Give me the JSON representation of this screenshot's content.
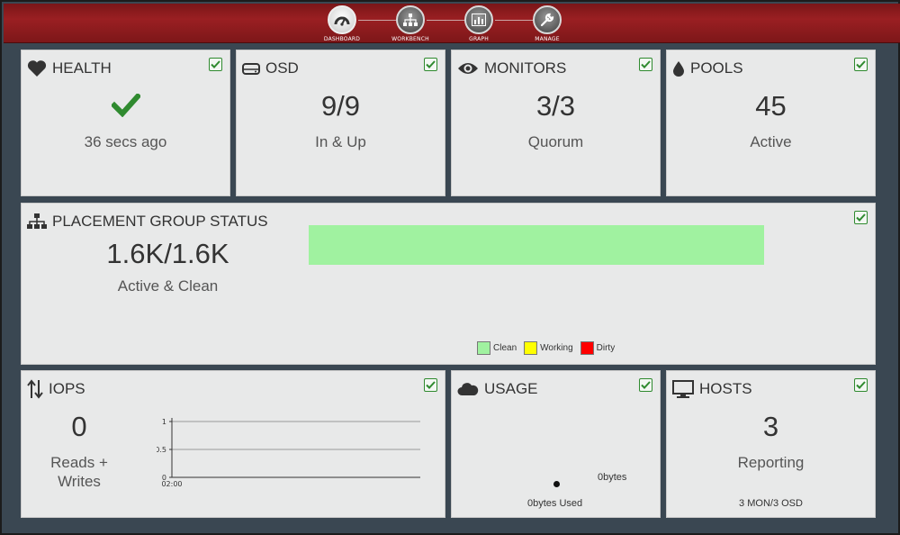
{
  "nav": {
    "items": [
      {
        "label": "DASHBOARD",
        "icon": "gauge-icon",
        "active": true
      },
      {
        "label": "WORKBENCH",
        "icon": "sitemap-icon",
        "active": false
      },
      {
        "label": "GRAPH",
        "icon": "chart-icon",
        "active": false
      },
      {
        "label": "MANAGE",
        "icon": "wrench-icon",
        "active": false
      }
    ]
  },
  "health": {
    "title": "HEALTH",
    "status_icon": "checkmark-icon",
    "label": "36 secs ago"
  },
  "osd": {
    "title": "OSD",
    "value": "9/9",
    "label": "In & Up"
  },
  "monitors": {
    "title": "MONITORS",
    "value": "3/3",
    "label": "Quorum"
  },
  "pools": {
    "title": "POOLS",
    "value": "45",
    "label": "Active"
  },
  "placement": {
    "title": "PLACEMENT GROUP STATUS",
    "value": "1.6K/1.6K",
    "label": "Active & Clean",
    "legend": [
      {
        "label": "Clean",
        "color": "#a0f2a0"
      },
      {
        "label": "Working",
        "color": "#ffff00"
      },
      {
        "label": "Dirty",
        "color": "#ff0000"
      }
    ],
    "clean_fraction": 1.0
  },
  "iops": {
    "title": "IOPS",
    "value": "0",
    "label_line1": "Reads +",
    "label_line2": "Writes",
    "chart_y_ticks": [
      "1",
      "0.5",
      "0"
    ],
    "chart_x_tick": "02:00"
  },
  "usage": {
    "title": "USAGE",
    "value_label": "0bytes",
    "used_label": "0bytes Used"
  },
  "hosts": {
    "title": "HOSTS",
    "value": "3",
    "label": "Reporting",
    "detail": "3 MON/3 OSD"
  },
  "colors": {
    "nav_red": "#8b1a1c",
    "check_green": "#2f8a2f",
    "background": "#3a4752",
    "card": "#e8e9e9",
    "clean_green": "#a0f2a0"
  }
}
